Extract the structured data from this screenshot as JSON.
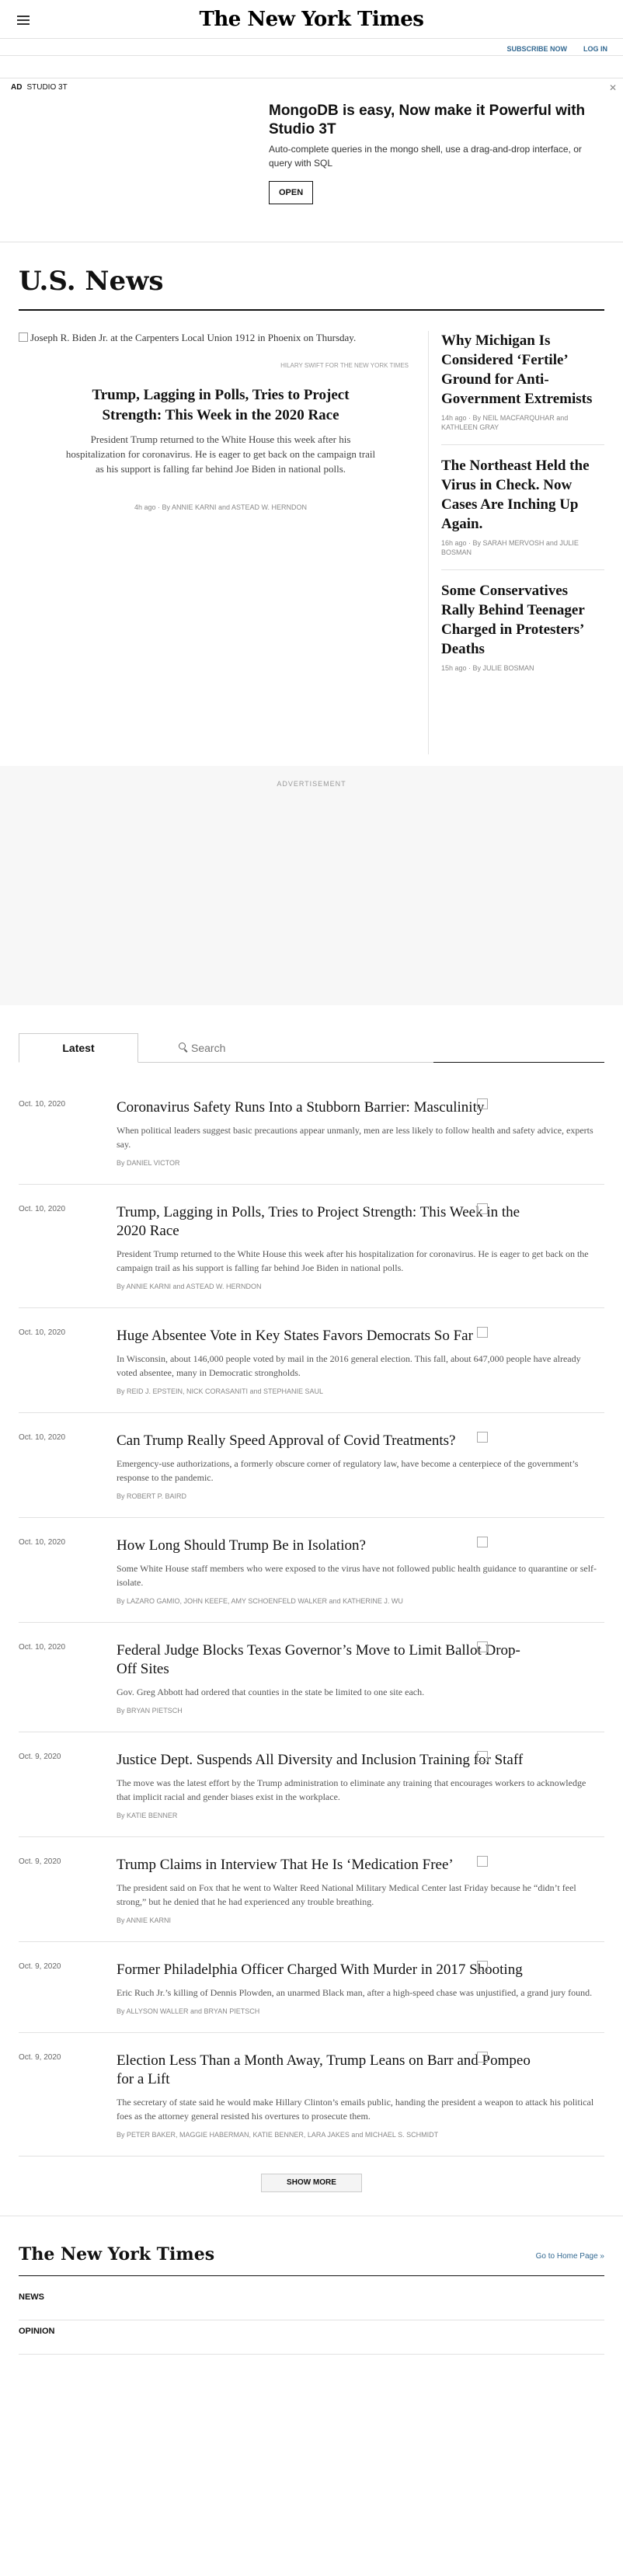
{
  "masthead": {
    "logo": "The New York Times",
    "subscribe": "SUBSCRIBE NOW",
    "login": "LOG IN"
  },
  "ad": {
    "label": "AD",
    "advertiser": "STUDIO 3T",
    "title": "MongoDB is easy, Now make it Powerful with Studio 3T",
    "body": "Auto-complete queries in the mongo shell, use a drag-and-drop interface, or query with SQL",
    "cta": "OPEN",
    "close": "✕"
  },
  "section": {
    "title": "U.S. News"
  },
  "lead": {
    "image_alt": "Joseph R. Biden Jr. at the Carpenters Local Union 1912 in Phoenix on Thursday.",
    "credit": "Hilary Swift for The New York Times",
    "headline": "Trump, Lagging in Polls, Tries to Project Strength: This Week in the 2020 Race",
    "summary": "President Trump returned to the White House this week after his hospitalization for coronavirus. He is eager to get back on the campaign trail as his support is falling far behind Joe Biden in national polls.",
    "byline": "4h ago · By ANNIE KARNI and ASTEAD W. HERNDON"
  },
  "side_stories": [
    {
      "headline": "Why Michigan Is Considered ‘Fertile’ Ground for Anti-Government Extremists",
      "byline": "14h ago · By NEIL MACFARQUHAR and KATHLEEN GRAY"
    },
    {
      "headline": "The Northeast Held the Virus in Check. Now Cases Are Inching Up Again.",
      "byline": "16h ago · By SARAH MERVOSH and JULIE BOSMAN"
    },
    {
      "headline": "Some Conservatives Rally Behind Teenager Charged in Protesters’ Deaths",
      "byline": "15h ago · By JULIE BOSMAN"
    }
  ],
  "advertisement_label": "ADVERTISEMENT",
  "tabs": {
    "latest": "Latest",
    "search_placeholder": "Search"
  },
  "stories": [
    {
      "date": "Oct. 10, 2020",
      "headline": "Coronavirus Safety Runs Into a Stubborn Barrier: Masculinity",
      "summary": "When political leaders suggest basic precautions appear unmanly, men are less likely to follow health and safety advice, experts say.",
      "byline": "By DANIEL VICTOR"
    },
    {
      "date": "Oct. 10, 2020",
      "headline": "Trump, Lagging in Polls, Tries to Project Strength: This Week in the 2020 Race",
      "summary": "President Trump returned to the White House this week after his hospitalization for coronavirus. He is eager to get back on the campaign trail as his support is falling far behind Joe Biden in national polls.",
      "byline": "By ANNIE KARNI and ASTEAD W. HERNDON"
    },
    {
      "date": "Oct. 10, 2020",
      "headline": "Huge Absentee Vote in Key States Favors Democrats So Far",
      "summary": "In Wisconsin, about 146,000 people voted by mail in the 2016 general election. This fall, about 647,000 people have already voted absentee, many in Democratic strongholds.",
      "byline": "By REID J. EPSTEIN, NICK CORASANITI and STEPHANIE SAUL"
    },
    {
      "date": "Oct. 10, 2020",
      "headline": "Can Trump Really Speed Approval of Covid Treatments?",
      "summary": "Emergency-use authorizations, a formerly obscure corner of regulatory law, have become a centerpiece of the government’s response to the pandemic.",
      "byline": "By ROBERT P. BAIRD"
    },
    {
      "date": "Oct. 10, 2020",
      "headline": "How Long Should Trump Be in Isolation?",
      "summary": "Some White House staff members who were exposed to the virus have not followed public health guidance to quarantine or self-isolate.",
      "byline": "By LAZARO GAMIO, JOHN KEEFE, AMY SCHOENFELD WALKER and KATHERINE J. WU"
    },
    {
      "date": "Oct. 10, 2020",
      "headline": "Federal Judge Blocks Texas Governor’s Move to Limit Ballot Drop-Off Sites",
      "summary": "Gov. Greg Abbott had ordered that counties in the state be limited to one site each.",
      "byline": "By BRYAN PIETSCH"
    },
    {
      "date": "Oct. 9, 2020",
      "headline": "Justice Dept. Suspends All Diversity and Inclusion Training for Staff",
      "summary": "The move was the latest effort by the Trump administration to eliminate any training that encourages workers to acknowledge that implicit racial and gender biases exist in the workplace.",
      "byline": "By KATIE BENNER"
    },
    {
      "date": "Oct. 9, 2020",
      "headline": "Trump Claims in Interview That He Is ‘Medication Free’",
      "summary": "The president said on Fox that he went to Walter Reed National Military Medical Center last Friday because he “didn’t feel strong,” but he denied that he had experienced any trouble breathing.",
      "byline": "By ANNIE KARNI"
    },
    {
      "date": "Oct. 9, 2020",
      "headline": "Former Philadelphia Officer Charged With Murder in 2017 Shooting",
      "summary": "Eric Ruch Jr.’s killing of Dennis Plowden, an unarmed Black man, after a high-speed chase was unjustified, a grand jury found.",
      "byline": "By ALLYSON WALLER and BRYAN PIETSCH"
    },
    {
      "date": "Oct. 9, 2020",
      "headline": "Election Less Than a Month Away, Trump Leans on Barr and Pompeo for a Lift",
      "summary": "The secretary of state said he would make Hillary Clinton’s emails public, handing the president a weapon to attack his political foes as the attorney general resisted his overtures to prosecute them.",
      "byline": "By PETER BAKER, MAGGIE HABERMAN, KATIE BENNER, LARA JAKES and MICHAEL S. SCHMIDT"
    }
  ],
  "show_more": "SHOW MORE",
  "footer": {
    "logo": "The New York Times",
    "home_link": "Go to Home Page »",
    "nav": [
      "NEWS",
      "OPINION"
    ]
  }
}
